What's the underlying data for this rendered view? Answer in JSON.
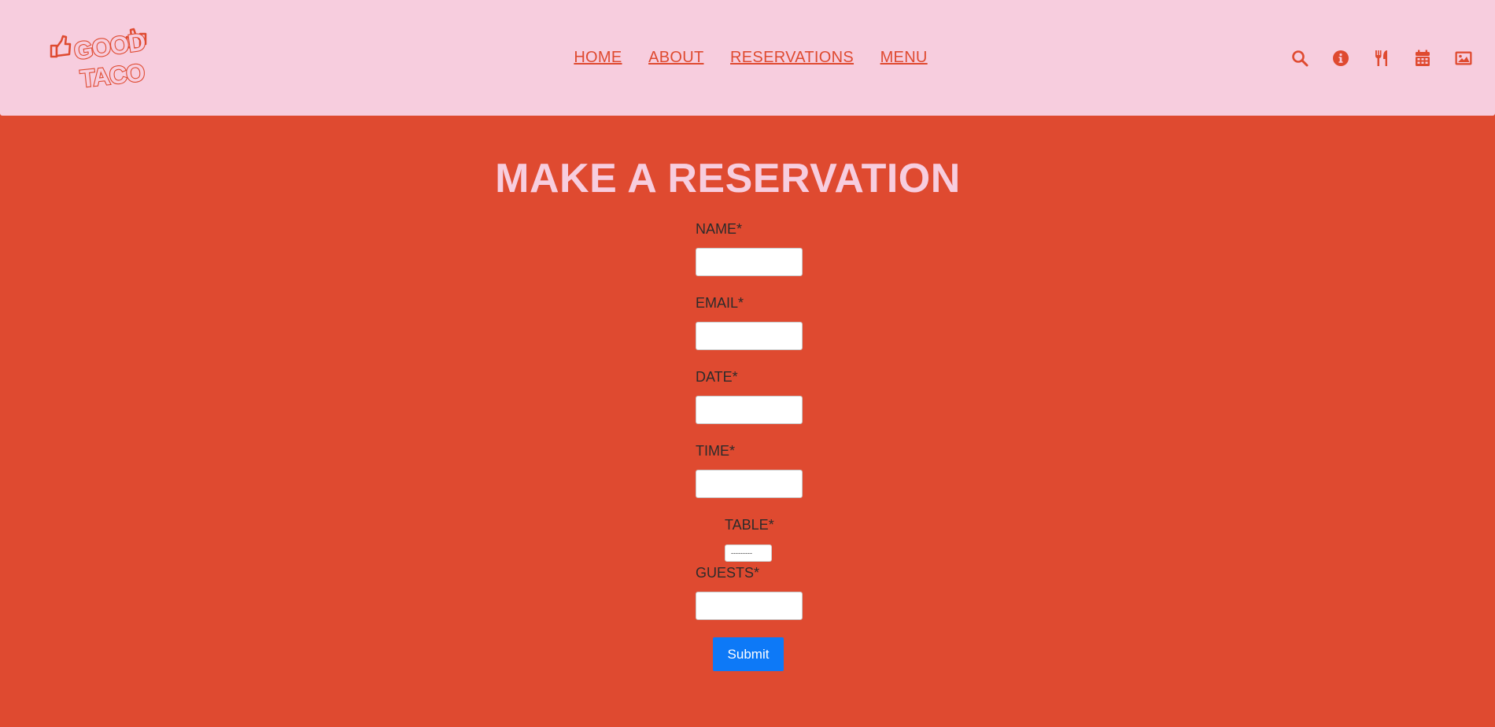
{
  "brand": {
    "logo_text_line1": "GOOD",
    "logo_text_line2": "TACO",
    "color": "#df4a30",
    "header_bg": "#f7cdde"
  },
  "nav": {
    "items": [
      {
        "label": "HOME"
      },
      {
        "label": "ABOUT"
      },
      {
        "label": "RESERVATIONS"
      },
      {
        "label": "MENU"
      }
    ]
  },
  "header_icons": [
    "search-icon",
    "info-icon",
    "utensils-icon",
    "calendar-icon",
    "image-icon"
  ],
  "page": {
    "title": "MAKE A RESERVATION",
    "background": "#df4a30"
  },
  "form": {
    "name_label": "NAME*",
    "name_value": "",
    "email_label": "EMAIL*",
    "email_value": "",
    "date_label": "DATE*",
    "date_value": "",
    "time_label": "TIME*",
    "time_value": "",
    "table_label": "TABLE*",
    "table_selected": "---------",
    "guests_label": "GUESTS*",
    "guests_value": "",
    "submit_label": "Submit",
    "submit_color": "#0d79f7"
  }
}
